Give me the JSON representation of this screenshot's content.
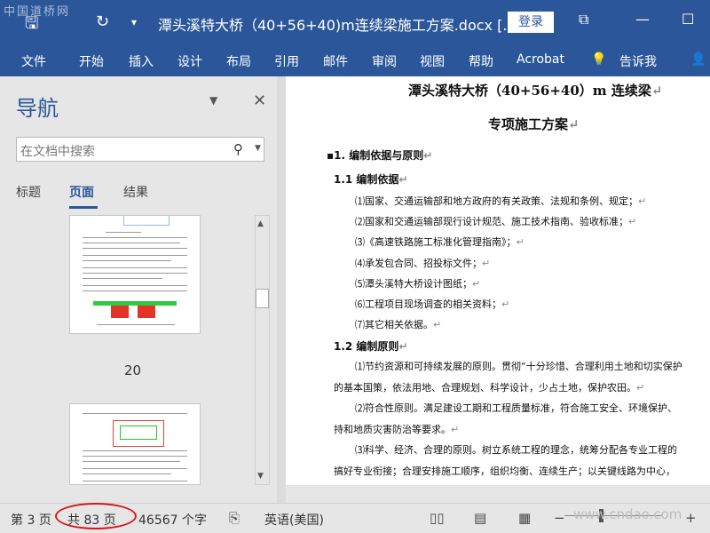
{
  "watermark_top": "中国道桥网",
  "watermark_bottom": "www.cndao.com",
  "titlebar": {
    "doc_title": "潭头溪特大桥（40+56+40)m连续梁施工方案.docx [...",
    "login_label": "登录"
  },
  "ribbon": {
    "tabs": [
      "文件",
      "开始",
      "插入",
      "设计",
      "布局",
      "引用",
      "邮件",
      "审阅",
      "视图",
      "帮助",
      "Acrobat"
    ],
    "tell_me": "告诉我"
  },
  "nav": {
    "title": "导航",
    "search_placeholder": "在文档中搜索",
    "tabs": [
      "标题",
      "页面",
      "结果"
    ],
    "active_tab": "页面",
    "thumb_page_num": "20"
  },
  "document": {
    "title_line1": "潭头溪特大桥（40+56+40）m 连续梁",
    "title_line2": "专项施工方案",
    "heading1": "1. 编制依据与原则",
    "heading1_1": "1.1 编制依据",
    "basis_items": [
      "⑴国家、交通运输部和地方政府的有关政策、法规和条例、规定；",
      "⑵国家和交通运输部现行设计规范、施工技术指南、验收标准；",
      "⑶《高速铁路施工标准化管理指南》；",
      "⑷承发包合同、招投标文件；",
      "⑸潭头溪特大桥设计图纸；",
      "⑹工程项目现场调查的相关资料；",
      "⑺其它相关依据。"
    ],
    "heading1_2": "1.2 编制原则",
    "principles": [
      "⑴节约资源和可持续发展的原则。贯彻“十分珍惜、合理利用土地和切实保护",
      "的基本国策，依法用地、合理规划、科学设计，少占土地，保护农田。",
      "⑵符合性原则。满足建设工期和工程质量标准，符合施工安全、环境保护、",
      "持和地质灾害防治等要求。",
      "⑶科学、经济、合理的原则。树立系统工程的理念，统筹分配各专业工程的",
      "搞好专业衔接；合理安排施工顺序，组织均衡、连续生产；以关键线路为中心，"
    ]
  },
  "status": {
    "page": "第 3 页",
    "total": "共 83 页",
    "words": "46567 个字",
    "language": "英语(美国)"
  },
  "colors": {
    "accent": "#2b579a",
    "annotation": "#d8161b"
  }
}
